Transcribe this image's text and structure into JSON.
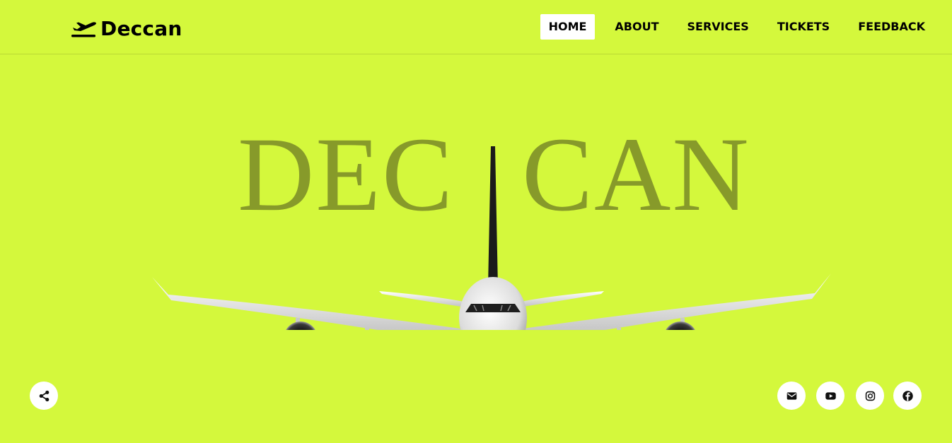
{
  "brand": {
    "name": "Deccan",
    "icon": "plane-takeoff-icon"
  },
  "nav": {
    "items": [
      {
        "label": "HOME",
        "active": true
      },
      {
        "label": "ABOUT",
        "active": false
      },
      {
        "label": "SERVICES",
        "active": false
      },
      {
        "label": "TICKETS",
        "active": false
      },
      {
        "label": "FEEDBACK",
        "active": false
      }
    ]
  },
  "hero": {
    "title_left": "DEC",
    "title_right": "CAN",
    "image": "airplane-front-view"
  },
  "share": {
    "icon": "share-icon"
  },
  "social": [
    {
      "icon": "envelope-icon"
    },
    {
      "icon": "youtube-icon"
    },
    {
      "icon": "instagram-icon"
    },
    {
      "icon": "facebook-icon"
    }
  ],
  "colors": {
    "background": "#d4f83c",
    "hero_text": "#879a2a",
    "text": "#000000",
    "button_bg": "#ffffff"
  }
}
